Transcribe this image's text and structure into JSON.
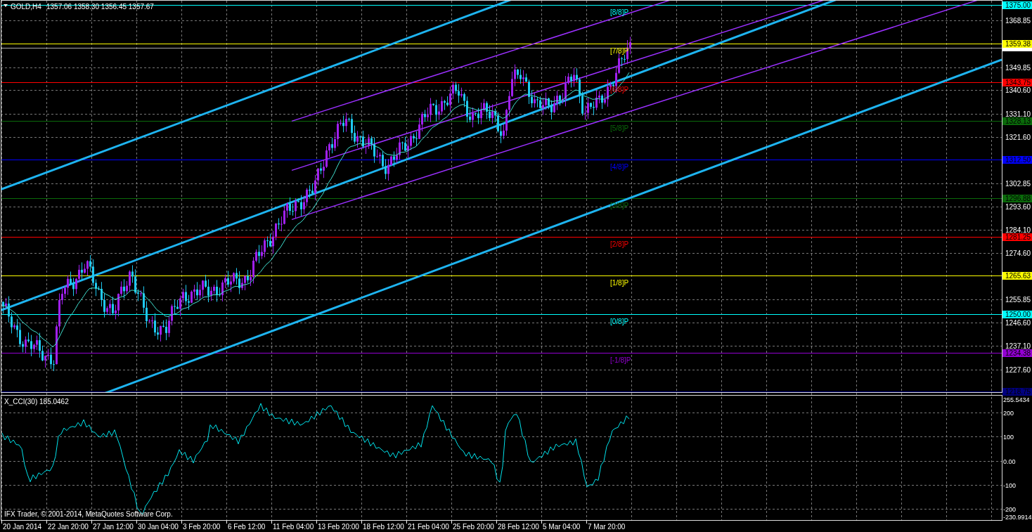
{
  "chart": {
    "symbol": "GOLD,H4",
    "quote": [
      "1357.06",
      "1358.30",
      "1356.45",
      "1357.67"
    ]
  },
  "price_axis": {
    "ticks": [
      "1368.85",
      "1349.85",
      "1340.60",
      "1331.10",
      "1321.60",
      "1302.85",
      "1293.60",
      "1284.10",
      "1274.60",
      "1255.85",
      "1246.60",
      "1237.10",
      "1227.60"
    ]
  },
  "levels": [
    {
      "price": "1375.00",
      "label": "[8/8]P",
      "color": "#00ffff"
    },
    {
      "price": "1359.38",
      "label": "[7/8]P",
      "color": "#ffff00"
    },
    {
      "price": "1343.75",
      "label": "[6/8]P",
      "color": "#ff0000"
    },
    {
      "price": "1328.13",
      "label": "[5/8]P",
      "color": "#0a6a0a"
    },
    {
      "price": "1312.50",
      "label": "[4/8]P",
      "color": "#0000ff"
    },
    {
      "price": "1296.88",
      "label": "[3/8]P",
      "color": "#0a6a0a"
    },
    {
      "price": "1281.25",
      "label": "[2/8]P",
      "color": "#ff0000"
    },
    {
      "price": "1265.63",
      "label": "[1/8]P",
      "color": "#ffff00"
    },
    {
      "price": "1250.00",
      "label": "[0/8]P",
      "color": "#00ffff"
    },
    {
      "price": "1234.38",
      "label": "[-1/8]P",
      "color": "#9400d3"
    },
    {
      "price": "1218.75",
      "color": "#000080"
    }
  ],
  "indicator": {
    "title": "X_CCI(30) 185.0462",
    "ticks": [
      "255.5434",
      "200",
      "100",
      "0.00",
      "-100",
      "-200",
      "-230.9914"
    ]
  },
  "time_axis": [
    "20 Jan 2014",
    "22 Jan 20:00",
    "27 Jan 12:00",
    "30 Jan 04:00",
    "3 Feb 20:00",
    "6 Feb 12:00",
    "11 Feb 04:00",
    "13 Feb 20:00",
    "18 Feb 12:00",
    "21 Feb 04:00",
    "25 Feb 20:00",
    "28 Feb 12:00",
    "5 Mar 04:00",
    "7 Mar 20:00"
  ],
  "copyright": "IFX Trader, © 2001-2014, MetaQuotes Software Corp."
}
